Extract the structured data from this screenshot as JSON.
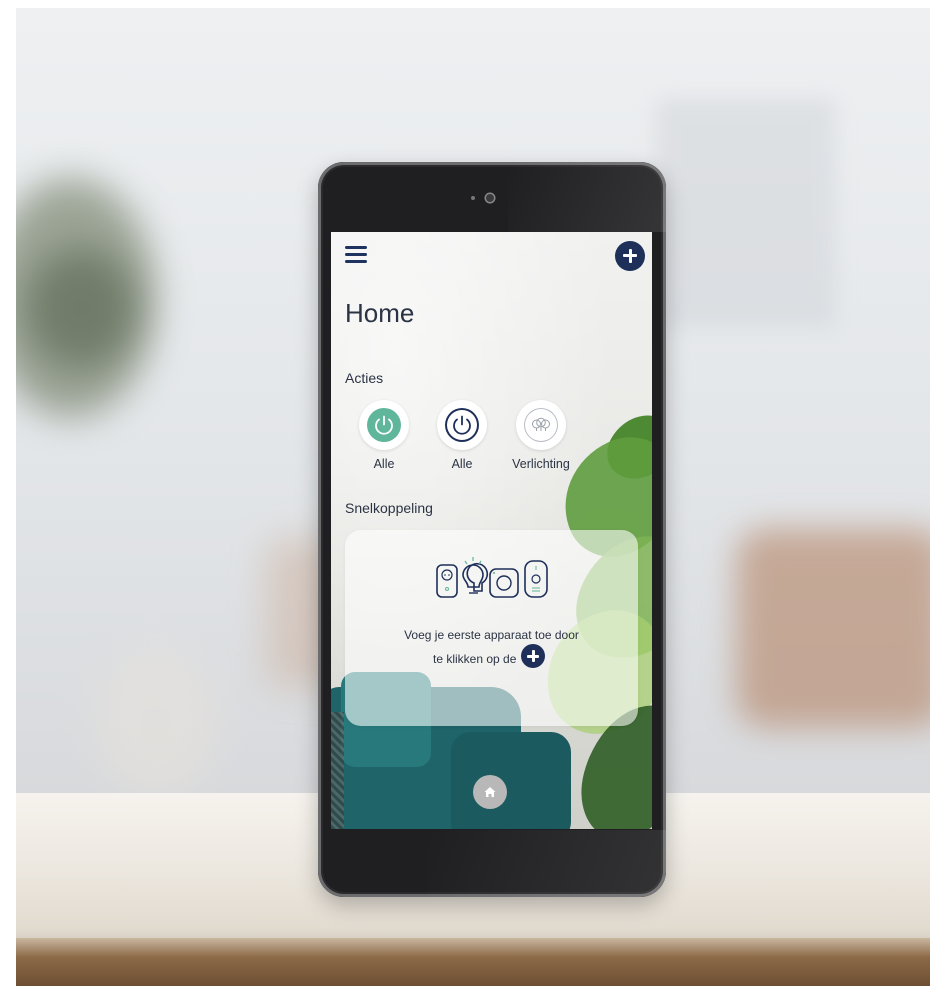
{
  "header": {
    "menu_icon": "hamburger-menu-icon",
    "add_icon": "plus-circle-icon"
  },
  "page": {
    "title": "Home"
  },
  "acties": {
    "heading": "Acties",
    "items": [
      {
        "label": "Alle",
        "icon": "power-icon",
        "style": "filled"
      },
      {
        "label": "Alle",
        "icon": "power-icon",
        "style": "outline"
      },
      {
        "label": "Verlichting",
        "icon": "light-bulbs-icon",
        "style": "light"
      }
    ]
  },
  "snelkoppeling": {
    "heading": "Snelkoppeling",
    "card": {
      "illustration": "smart-devices-icon",
      "text_line1": "Voeg je eerste apparaat toe door",
      "text_line2": "te klikken op de"
    }
  },
  "bottom_nav": {
    "home_icon": "home-icon"
  },
  "colors": {
    "accent_navy": "#1e2f5a",
    "accent_green": "#5fb69a",
    "text": "#2b3444"
  }
}
